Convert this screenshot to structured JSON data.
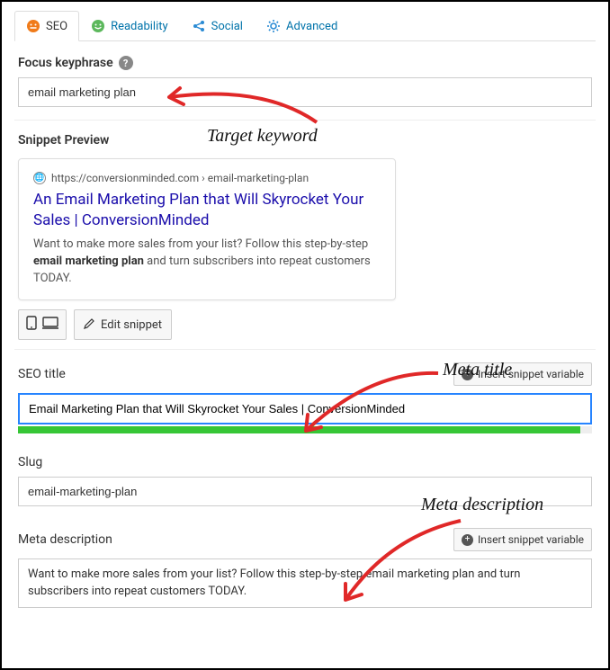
{
  "tabs": {
    "seo": "SEO",
    "readability": "Readability",
    "social": "Social",
    "advanced": "Advanced"
  },
  "focus": {
    "label": "Focus keyphrase",
    "value": "email marketing plan"
  },
  "snippet": {
    "heading": "Snippet Preview",
    "url": "https://conversionminded.com › email-marketing-plan",
    "title": "An Email Marketing Plan that Will Skyrocket Your Sales | ConversionMinded",
    "desc_pre": "Want to make more sales from your list? Follow this step-by-step ",
    "desc_bold": "email marketing plan",
    "desc_post": " and turn subscribers into repeat customers TODAY.",
    "edit_label": "Edit snippet"
  },
  "seo_title": {
    "label": "SEO title",
    "insert_label": "Insert snippet variable",
    "value": "Email Marketing Plan that Will Skyrocket Your Sales | ConversionMinded"
  },
  "slug": {
    "label": "Slug",
    "value": "email-marketing-plan"
  },
  "meta": {
    "label": "Meta description",
    "insert_label": "Insert snippet variable",
    "value": "Want to make more sales from your list? Follow this step-by-step email marketing plan and turn subscribers into repeat customers TODAY."
  },
  "annotations": {
    "keyword": "Target keyword",
    "title": "Meta title",
    "desc": "Meta description"
  }
}
